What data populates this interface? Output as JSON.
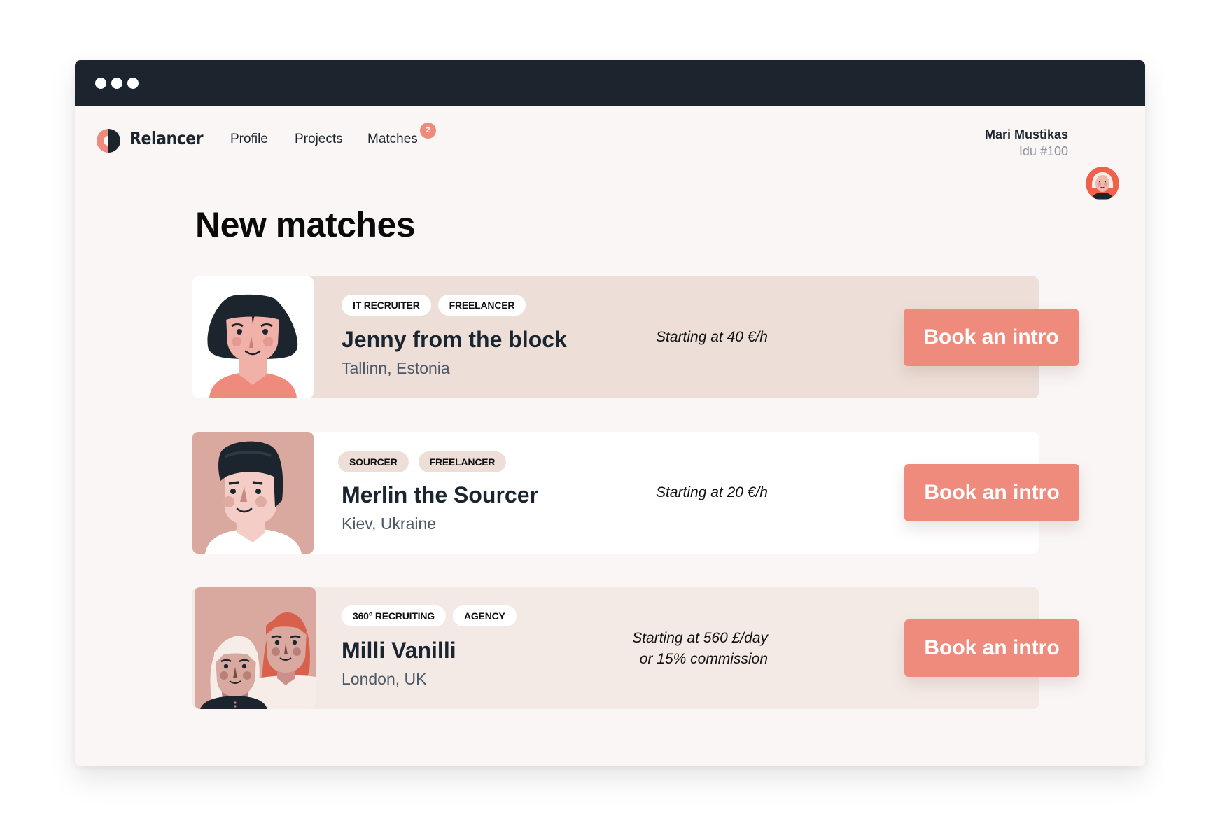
{
  "window": {
    "controls": [
      "dot",
      "dot",
      "dot"
    ]
  },
  "navbar": {
    "brand": "Relancer",
    "links": [
      {
        "label": "Profile"
      },
      {
        "label": "Projects"
      },
      {
        "label": "Matches",
        "badge": "2"
      }
    ],
    "user": {
      "name": "Mari Mustikas",
      "id_label": "Idu #100",
      "avatar_icon": "user-avatar-icon"
    }
  },
  "main": {
    "title": "New matches",
    "matches": [
      {
        "tags": [
          "IT RECRUITER",
          "FREELANCER"
        ],
        "name": "Jenny from the block",
        "location": "Tallinn, Estonia",
        "price_line1": "Starting at 40 €/h",
        "price_line2": "",
        "button": "Book an intro",
        "avatar_icon": "woman-avatar-icon"
      },
      {
        "tags": [
          "SOURCER",
          "FREELANCER"
        ],
        "name": "Merlin the Sourcer",
        "location": "Kiev, Ukraine",
        "price_line1": "Starting at 20 €/h",
        "price_line2": "",
        "button": "Book an intro",
        "avatar_icon": "man-avatar-icon"
      },
      {
        "tags": [
          "360° RECRUITING",
          "AGENCY"
        ],
        "name": "Milli Vanilli",
        "location": "London, UK",
        "price_line1": "Starting at 560 £/day",
        "price_line2": "or 15% commission",
        "button": "Book an intro",
        "avatar_icon": "two-women-avatar-icon"
      }
    ]
  },
  "colors": {
    "accent": "#ef8b7c",
    "titlebar": "#1c252e",
    "page_bg": "#faf6f5",
    "card_1_bg": "#eddfd8",
    "card_2_bg": "#ffffff",
    "card_3_bg": "#f4eae5"
  }
}
